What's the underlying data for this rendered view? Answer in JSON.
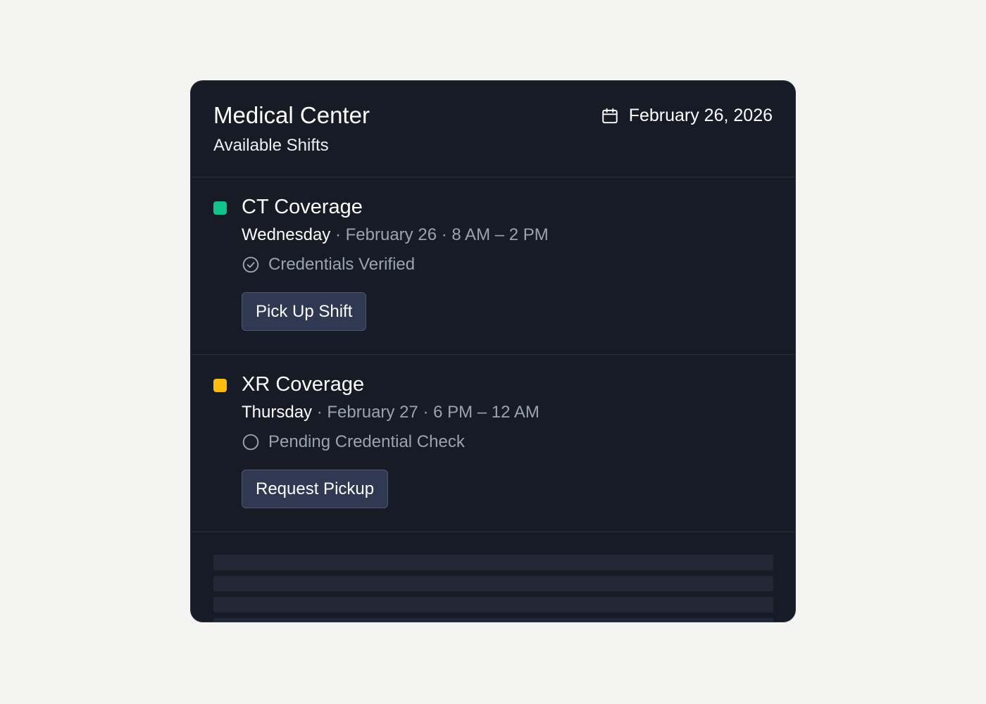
{
  "header": {
    "title": "Medical Center",
    "subtitle": "Available Shifts",
    "date": "February 26, 2026",
    "date_icon": "calendar-icon"
  },
  "shifts": [
    {
      "name": "CT Coverage",
      "color": "#10c48b",
      "day": "Wednesday",
      "details": " · February 26 · 8 AM – 2 PM",
      "status": "Credentials Verified",
      "status_icon": "check-circle-icon",
      "action": "Pick Up Shift"
    },
    {
      "name": "XR Coverage",
      "color": "#fbbc0e",
      "day": "Thursday",
      "details": " · February 27 · 6 PM – 12 AM",
      "status": "Pending Credential Check",
      "status_icon": "empty-circle-icon",
      "action": "Request Pickup"
    }
  ],
  "colors": {
    "background": "#f4f4f2",
    "card": "#161b25",
    "button": "#2f3a52",
    "muted_text": "#9aa3b2"
  }
}
